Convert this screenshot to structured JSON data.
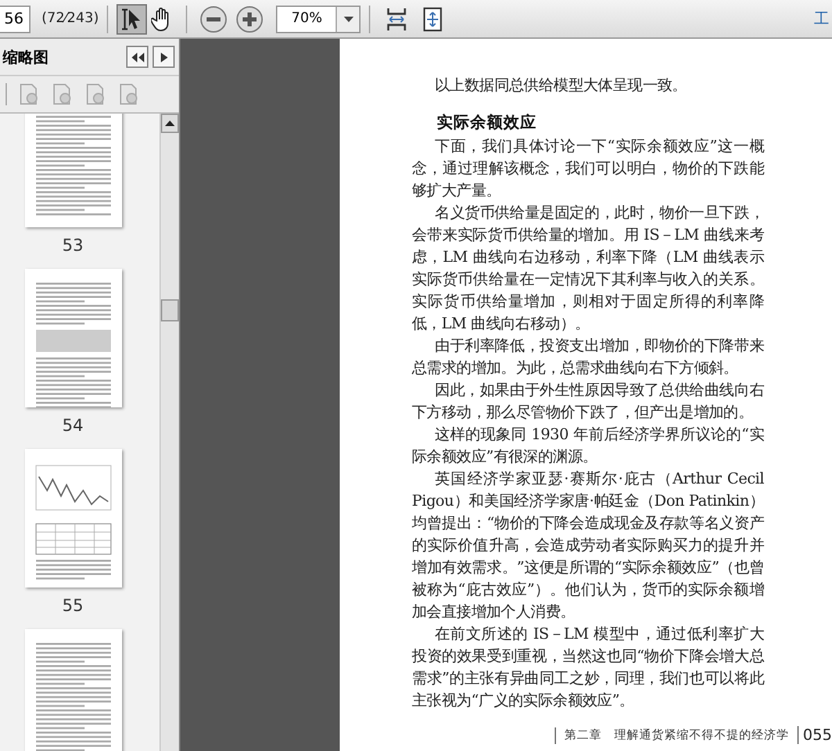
{
  "toolbar": {
    "page_number": "56",
    "page_count": "(72⁄243)",
    "tools": [
      {
        "kind": "select",
        "selected": true
      },
      {
        "kind": "hand",
        "selected": false
      }
    ],
    "zoom": "70%",
    "menu_label": "工"
  },
  "sidebar": {
    "title": "缩略图",
    "thumbnails": [
      {
        "kind": "text",
        "label": "53",
        "selected": false
      },
      {
        "kind": "table",
        "label": "54",
        "selected": false
      },
      {
        "kind": "chart",
        "label": "55",
        "selected": false
      },
      {
        "kind": "text",
        "selected": false
      }
    ]
  },
  "document": {
    "blocks": [
      {
        "kind": "paragraph",
        "text": "以上数据同总供给模型大体呈现一致。"
      },
      {
        "kind": "heading",
        "text": "实际余额效应"
      },
      {
        "kind": "paragraph",
        "text": "下面，我们具体讨论一下“实际余额效应”这一概念，通过理解该概念，我们可以明白，物价的下跌能够扩大产量。"
      },
      {
        "kind": "paragraph",
        "text": "名义货币供给量是固定的，此时，物价一旦下跌，会带来实际货币供给量的增加。用 IS－LM 曲线来考虑，LM 曲线向右边移动，利率下降（LM 曲线表示实际货币供给量在一定情况下其利率与收入的关系。实际货币供给量增加，则相对于固定所得的利率降低，LM 曲线向右移动）。"
      },
      {
        "kind": "paragraph",
        "text": "由于利率降低，投资支出增加，即物价的下降带来总需求的增加。为此，总需求曲线向右下方倾斜。"
      },
      {
        "kind": "paragraph",
        "text": "因此，如果由于外生性原因导致了总供给曲线向右下方移动，那么尽管物价下跌了，但产出是增加的。"
      },
      {
        "kind": "paragraph",
        "text": "这样的现象同 1930 年前后经济学界所议论的“实际余额效应”有很深的渊源。"
      },
      {
        "kind": "paragraph",
        "text": "英国经济学家亚瑟·赛斯尔·庇古（Arthur Cecil Pigou）和美国经济学家唐·帕廷金（Don Patinkin）均曾提出：“物价的下降会造成现金及存款等名义资产的实际价值升高，会造成劳动者实际购买力的提升并增加有效需求。”这便是所谓的“实际余额效应”（也曾被称为“庇古效应”）。他们认为，货币的实际余额增加会直接增加个人消费。"
      },
      {
        "kind": "paragraph",
        "text": "在前文所述的 IS－LM 模型中，通过低利率扩大投资的效果受到重视，当然这也同“物价下降会增大总需求”的主张有异曲同工之妙，同理，我们也可以将此主张视为“广义的实际余额效应”。"
      }
    ],
    "footer": {
      "chapter": "第二章　理解通货紧缩不得不提的经济学",
      "page": "055"
    }
  }
}
